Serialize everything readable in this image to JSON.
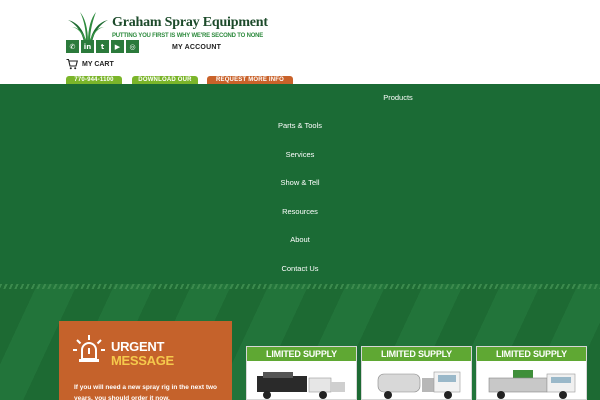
{
  "header": {
    "brand_name": "Graham Spray Equipment",
    "tagline": "PUTTING YOU FIRST IS WHY WE'RE SECOND TO NONE",
    "social_icons": [
      "phone-icon",
      "linkedin-icon",
      "twitter-icon",
      "youtube-icon",
      "instagram-icon"
    ],
    "social_glyphs": [
      "✆",
      "in",
      "t",
      "▶",
      "◎"
    ],
    "my_account": "MY ACCOUNT",
    "my_cart": "MY CART",
    "buttons": {
      "phone": "770-944-1100",
      "download": "DOWNLOAD OUR",
      "request": "REQUEST MORE INFO"
    }
  },
  "nav": {
    "items": [
      "Products",
      "Parts & Tools",
      "Services",
      "Show & Tell",
      "Resources",
      "About",
      "Contact Us"
    ]
  },
  "urgent": {
    "title_line1": "URGENT",
    "title_line2": "MESSAGE",
    "body": "If you will need a new spray rig in the next two years, you should order it now."
  },
  "cards": [
    {
      "label": "LIMITED SUPPLY"
    },
    {
      "label": "LIMITED SUPPLY"
    },
    {
      "label": "LIMITED SUPPLY"
    }
  ],
  "colors": {
    "nav_green": "#1b6b35",
    "brand_green": "#2e8b3e",
    "lime": "#7bb52a",
    "orange": "#c5622b",
    "gold": "#f5c94c"
  }
}
